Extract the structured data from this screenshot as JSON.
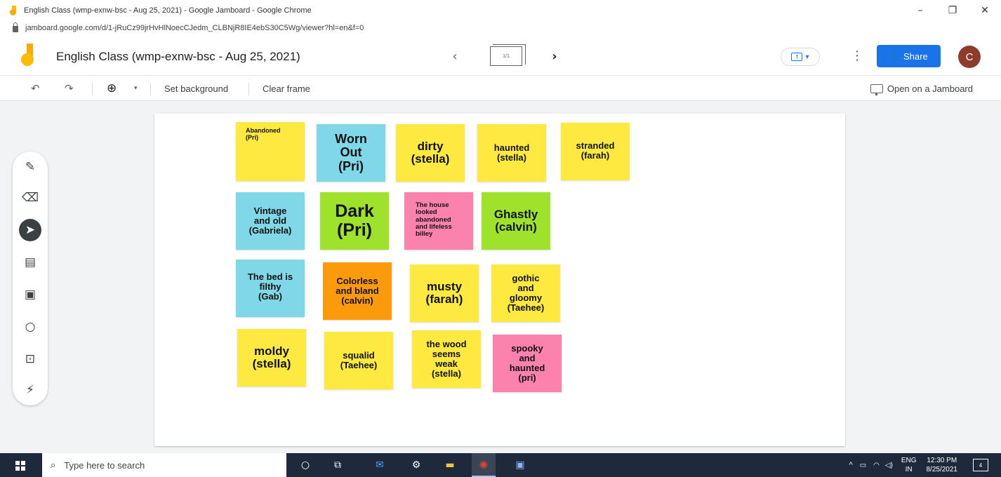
{
  "browser": {
    "window_title": "English Class (wmp-exnw-bsc - Aug 25, 2021) - Google Jamboard - Google Chrome",
    "url": "jamboard.google.com/d/1-jRuCz99jrHvHlNoecCJedm_CLBNjR8IE4ebS30C5Wg/viewer?hl=en&f=0",
    "controls": {
      "minimize": "–",
      "restore": "❐",
      "close": "✕"
    }
  },
  "header": {
    "title": "English Class (wmp-exnw-bsc - Aug 25, 2021)",
    "frame_counter": "1/1",
    "prev_icon": "‹",
    "next_icon": "›",
    "share_label": "Share",
    "avatar_letter": "C",
    "present_dropdown": "▾",
    "kebab": "⋮"
  },
  "toolbar": {
    "undo_icon": "↶",
    "redo_icon": "↷",
    "zoom_icon": "⊕",
    "zoom_dropdown": "▾",
    "set_background": "Set background",
    "clear_frame": "Clear frame",
    "open_on": "Open on a Jamboard"
  },
  "tools": [
    {
      "name": "pen-tool",
      "glyph": "✎",
      "active": false
    },
    {
      "name": "eraser-tool",
      "glyph": "⌫",
      "active": false
    },
    {
      "name": "select-tool",
      "glyph": "➤",
      "active": true
    },
    {
      "name": "sticky-note-tool",
      "glyph": "▤",
      "active": false
    },
    {
      "name": "image-tool",
      "glyph": "▣",
      "active": false
    },
    {
      "name": "circle-tool",
      "glyph": "○",
      "active": false
    },
    {
      "name": "text-box-tool",
      "glyph": "⊡",
      "active": false
    },
    {
      "name": "laser-tool",
      "glyph": "⚡",
      "active": false
    }
  ],
  "notes": [
    {
      "text": "Abandoned\n(Pri)",
      "color": "#fde93f"
    },
    {
      "text": "Worn\nOut\n(Pri)",
      "color": "#7fd7e7"
    },
    {
      "text": "dirty\n(stella)",
      "color": "#fde93f"
    },
    {
      "text": "haunted\n(stella)",
      "color": "#fde93f"
    },
    {
      "text": "stranded\n(farah)",
      "color": "#fde93f"
    },
    {
      "text": "Vintage\nand old\n(Gabriela)",
      "color": "#7fd7e7"
    },
    {
      "text": "Dark\n(Pri)",
      "color": "#9ee22c"
    },
    {
      "text": "The house\nlooked\nabandoned\nand lifeless\nbilley",
      "color": "#fc82ae"
    },
    {
      "text": "Ghastly\n(calvin)",
      "color": "#9ee22c"
    },
    {
      "text": "The bed is\nfilthy\n(Gab)",
      "color": "#7fd7e7"
    },
    {
      "text": "Colorless\nand bland\n(calvin)",
      "color": "#fb9a0a"
    },
    {
      "text": "musty\n(farah)",
      "color": "#fde93f"
    },
    {
      "text": "gothic\nand\ngloomy\n(Taehee)",
      "color": "#fde93f"
    },
    {
      "text": "moldy\n(stella)",
      "color": "#fde93f"
    },
    {
      "text": "squalid\n(Taehee)",
      "color": "#fde93f"
    },
    {
      "text": "the wood\nseems\nweak\n(stella)",
      "color": "#fde93f"
    },
    {
      "text": "spooky\nand\nhaunted\n(pri)",
      "color": "#fc82ae"
    }
  ],
  "taskbar": {
    "search_placeholder": "Type here to search",
    "lang_top": "ENG",
    "lang_bottom": "IN",
    "time": "12:30 PM",
    "date": "8/25/2021",
    "notifications": "4",
    "tray_chevron": "^"
  }
}
